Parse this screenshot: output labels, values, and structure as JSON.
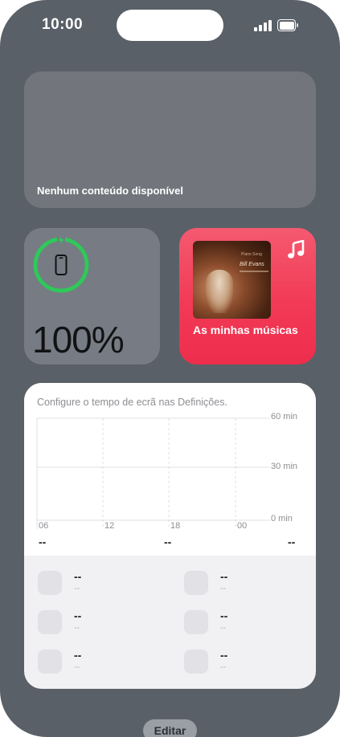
{
  "status_bar": {
    "time": "10:00",
    "signal_icon": "cellular-signal-icon",
    "battery_icon": "battery-full-icon"
  },
  "photos_widget": {
    "message": "Nenhum conteúdo disponível"
  },
  "battery_widget": {
    "percentage": "100%",
    "level": 1.0,
    "device_icon": "iphone-icon",
    "charging_icon": "bolt-icon",
    "ring_color": "#30c85a"
  },
  "music_widget": {
    "title": "As minhas músicas",
    "app_icon": "music-note-icon",
    "album_text_top": "Piano Song",
    "album_text_title": "Bill Evans",
    "accent": "#f23a56"
  },
  "screen_time_widget": {
    "message": "Configure o tempo de ecrã nas Definições.",
    "y_ticks": [
      "60 min",
      "30 min",
      "0 min"
    ],
    "x_ticks": [
      "06",
      "12",
      "18",
      "00"
    ],
    "summary": [
      "--",
      "--",
      "--"
    ],
    "apps": [
      {
        "name": "--",
        "time": "--"
      },
      {
        "name": "--",
        "time": "--"
      },
      {
        "name": "--",
        "time": "--"
      },
      {
        "name": "--",
        "time": "--"
      },
      {
        "name": "--",
        "time": "--"
      },
      {
        "name": "--",
        "time": "--"
      }
    ]
  },
  "edit_button": {
    "label": "Editar"
  },
  "colors": {
    "wallpaper": "#5a6068",
    "charging_green": "#30c85a",
    "music_red": "#f23a56"
  }
}
